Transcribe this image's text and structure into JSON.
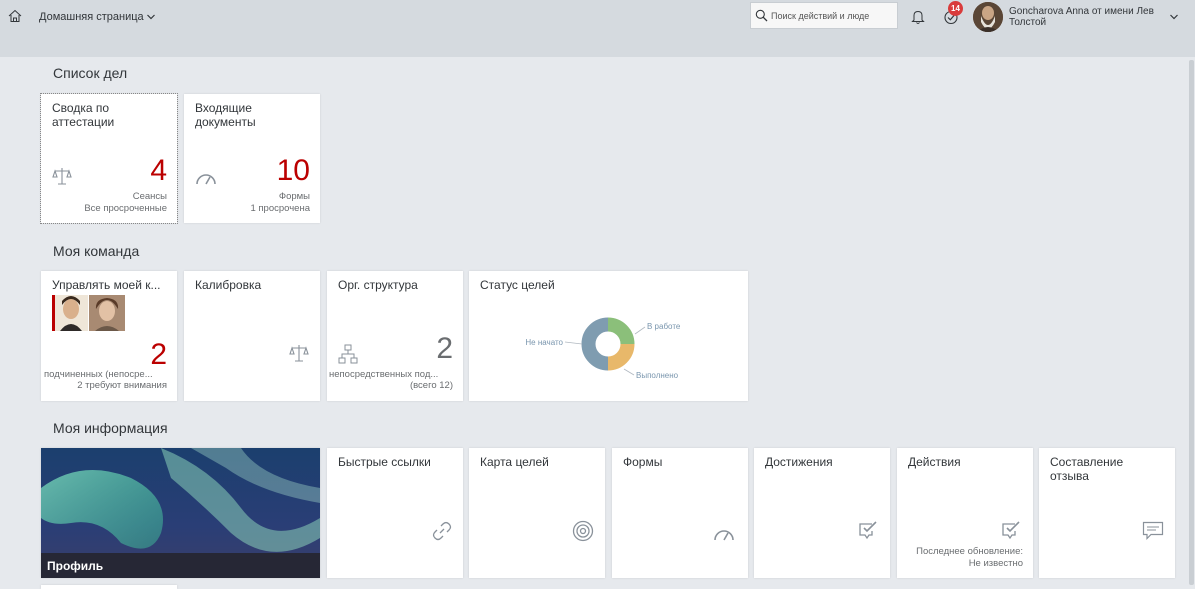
{
  "header": {
    "title": "Домашняя страница",
    "search_placeholder": "Поиск действий и люде",
    "notifications_badge": "14",
    "user_name": "Goncharova Anna от имени Лев Толстой",
    "icons": [
      "home-icon",
      "chevron-down-icon",
      "search-icon",
      "bell-icon",
      "tasks-icon",
      "avatar"
    ]
  },
  "sections": {
    "todo": "Список дел",
    "team": "Моя команда",
    "info": "Моя информация"
  },
  "todo_tiles": [
    {
      "title": "Сводка по аттестации",
      "kpi": "4",
      "unit": "Сеансы",
      "note": "Все просроченные",
      "icon": "scales-icon"
    },
    {
      "title": "Входящие документы",
      "kpi": "10",
      "unit": "Формы",
      "note": "1 просрочена",
      "icon": "gauge-icon"
    }
  ],
  "team_tiles": [
    {
      "title": "Управлять моей к...",
      "kpi": "2",
      "unit": "подчиненных (непосре...",
      "note": "2 требуют внимания",
      "icon": "avatar-photos"
    },
    {
      "title": "Калибровка",
      "icon": "scales-icon"
    },
    {
      "title": "Орг. структура",
      "kpi": "2",
      "unit": "непосредственных под...",
      "note": "(всего 12)",
      "icon": "org-chart-icon"
    },
    {
      "title": "Статус целей"
    }
  ],
  "goal_status_chart": {
    "labels": [
      "Не начато",
      "В работе",
      "Выполнено"
    ],
    "colors": [
      "#7f9cb0",
      "#8bbf7a",
      "#e8b86a"
    ],
    "values": [
      50,
      25,
      25
    ]
  },
  "info_tiles": [
    {
      "title": "Профиль",
      "icon": "aurora-photo"
    },
    {
      "title": "Быстрые ссылки",
      "icon": "link-icon"
    },
    {
      "title": "Карта целей",
      "icon": "target-icon"
    },
    {
      "title": "Формы",
      "icon": "gauge-icon"
    },
    {
      "title": "Достижения",
      "icon": "check-icon"
    },
    {
      "title": "Действия",
      "icon": "check-icon",
      "note_label": "Последнее обновление:",
      "note_value": "Не известно"
    },
    {
      "title": "Составление отзыва",
      "icon": "comment-icon"
    }
  ],
  "colors": {
    "accent_red": "#bb0000",
    "topbar": "#d5dadf",
    "background": "#e6e9ed"
  }
}
